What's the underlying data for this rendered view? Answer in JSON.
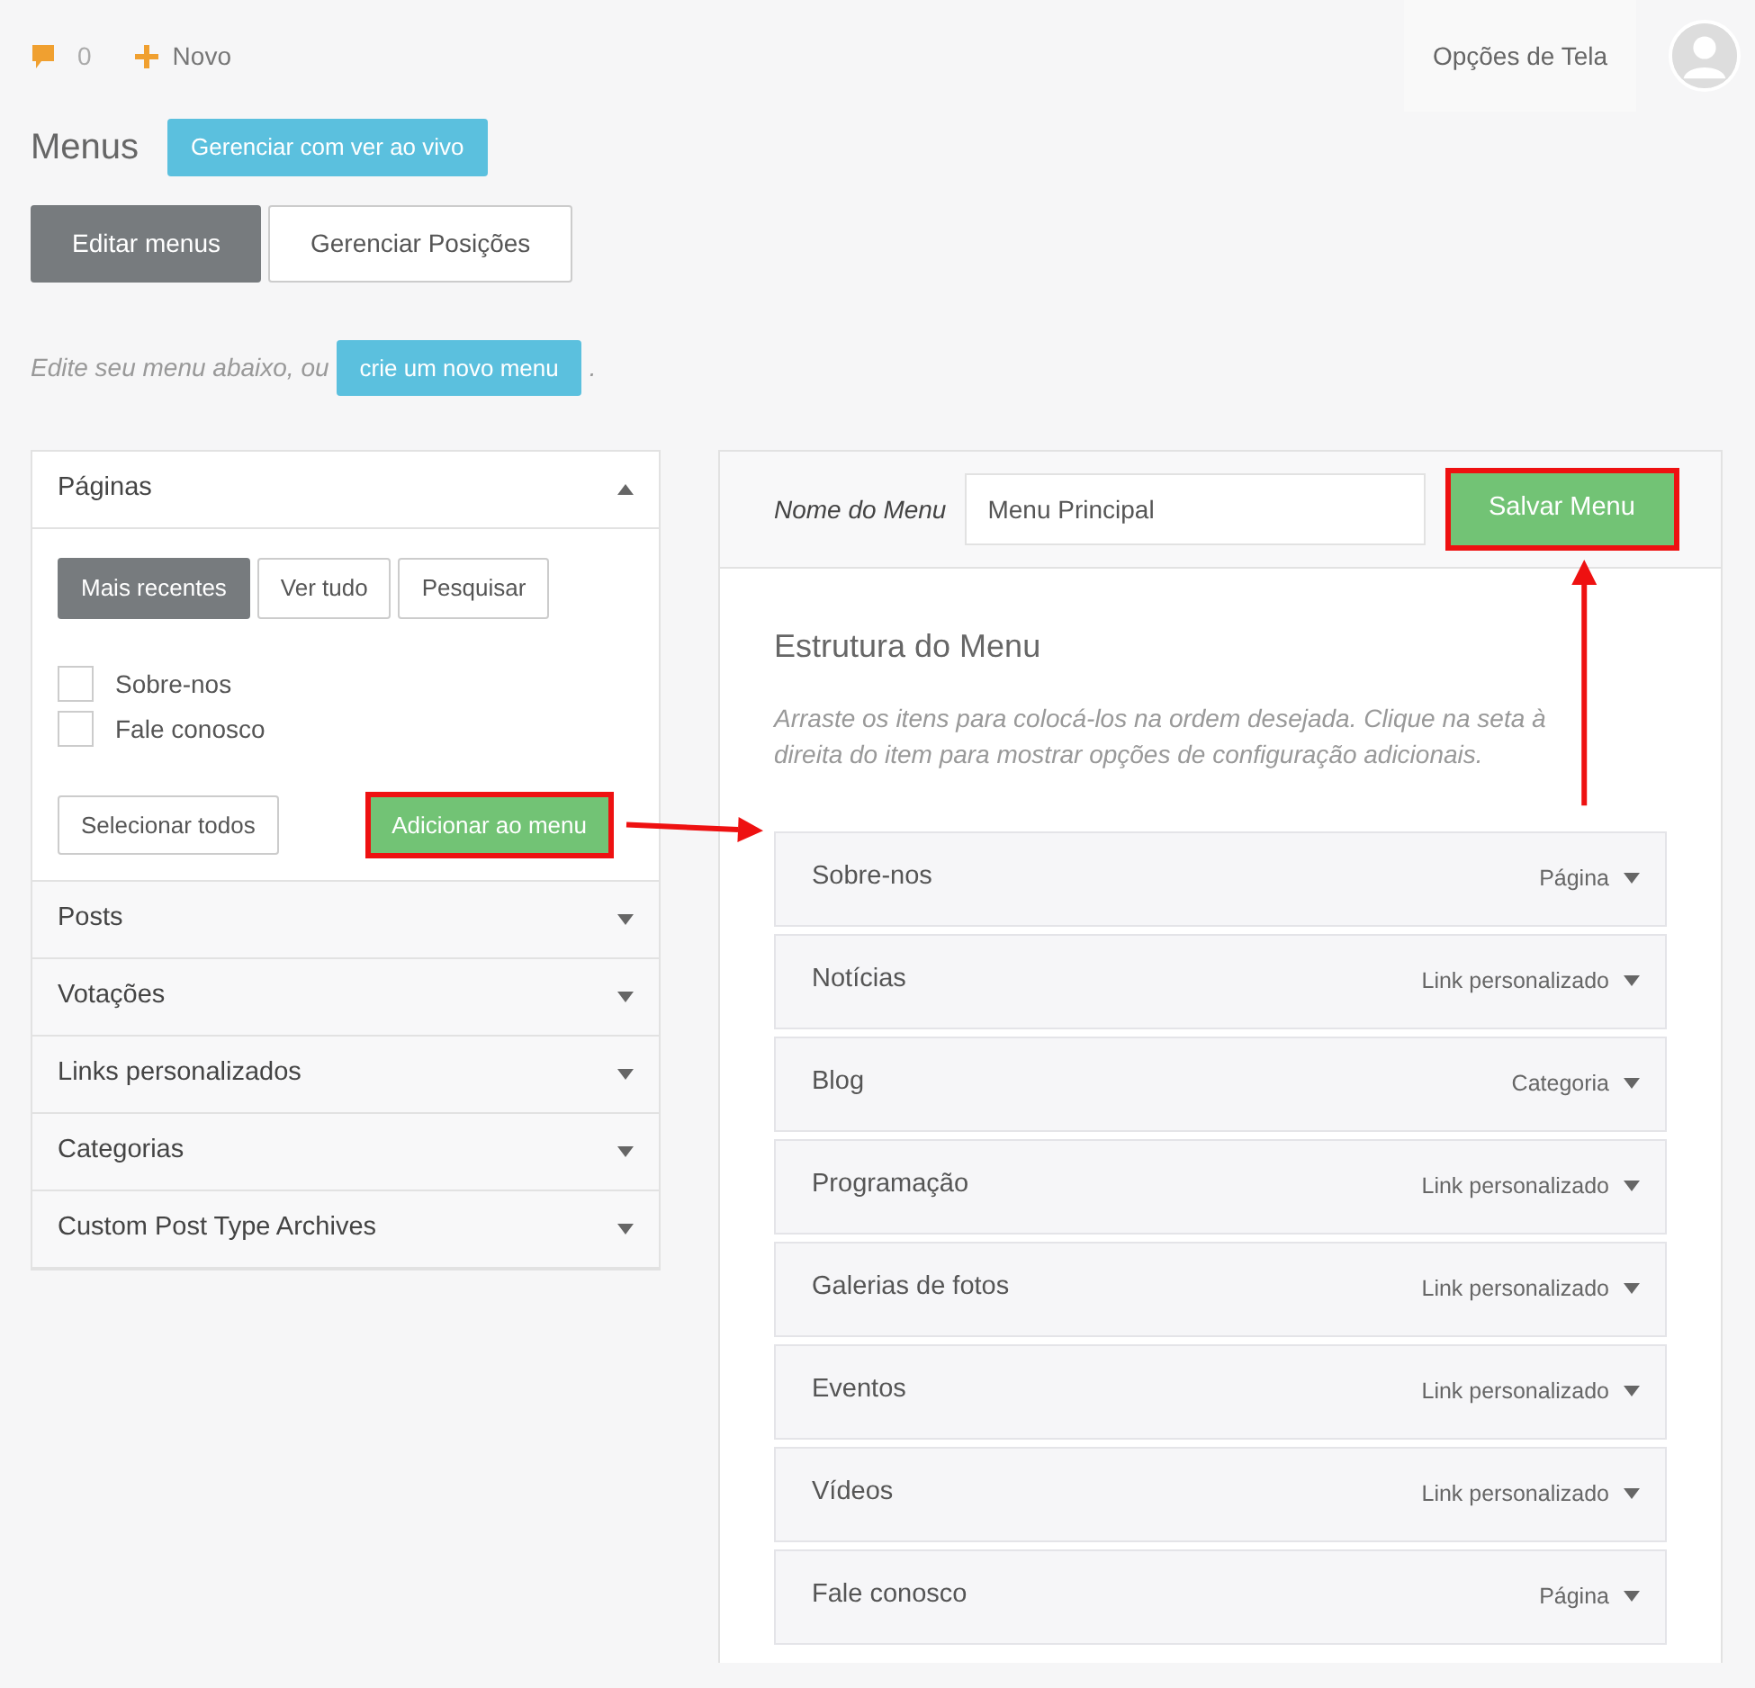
{
  "topbar": {
    "comments_count": "0",
    "new_label": "Novo",
    "screen_options": "Opções de Tela"
  },
  "header": {
    "title": "Menus",
    "live_button": "Gerenciar com ver ao vivo"
  },
  "nav_tabs": [
    {
      "label": "Editar menus",
      "selected": true
    },
    {
      "label": "Gerenciar Posições",
      "selected": false
    }
  ],
  "intro": {
    "text": "Edite seu menu abaixo, ou",
    "button": "crie um novo menu",
    "suffix": "."
  },
  "sections": [
    {
      "title": "Páginas",
      "expanded": true,
      "tabs": [
        {
          "label": "Mais recentes",
          "selected": true
        },
        {
          "label": "Ver tudo",
          "selected": false
        },
        {
          "label": "Pesquisar",
          "selected": false
        }
      ],
      "items": [
        {
          "label": "Sobre-nos",
          "checked": false
        },
        {
          "label": "Fale conosco",
          "checked": false
        }
      ],
      "select_all": "Selecionar todos",
      "add_button": {
        "label": "Adicionar ao menu",
        "highlighted": true
      }
    },
    {
      "title": "Posts",
      "expanded": false
    },
    {
      "title": "Votações",
      "expanded": false
    },
    {
      "title": "Links personalizados",
      "expanded": false
    },
    {
      "title": "Categorias",
      "expanded": false
    },
    {
      "title": "Custom Post Type Archives",
      "expanded": false
    }
  ],
  "menu_editor": {
    "name_label": "Nome do Menu",
    "name_value": "Menu Principal",
    "save_button": {
      "label": "Salvar Menu",
      "highlighted": true
    },
    "structure_title": "Estrutura do Menu",
    "instructions": "Arraste os itens para colocá-los na ordem desejada. Clique na seta à direita do item para mostrar opções de configuração adicionais.",
    "items": [
      {
        "title": "Sobre-nos",
        "type": "Página"
      },
      {
        "title": "Notícias",
        "type": "Link personalizado"
      },
      {
        "title": "Blog",
        "type": "Categoria"
      },
      {
        "title": "Programação",
        "type": "Link personalizado"
      },
      {
        "title": "Galerias de fotos",
        "type": "Link personalizado"
      },
      {
        "title": "Eventos",
        "type": "Link personalizado"
      },
      {
        "title": "Vídeos",
        "type": "Link personalizado"
      },
      {
        "title": "Fale conosco",
        "type": "Página"
      }
    ]
  }
}
